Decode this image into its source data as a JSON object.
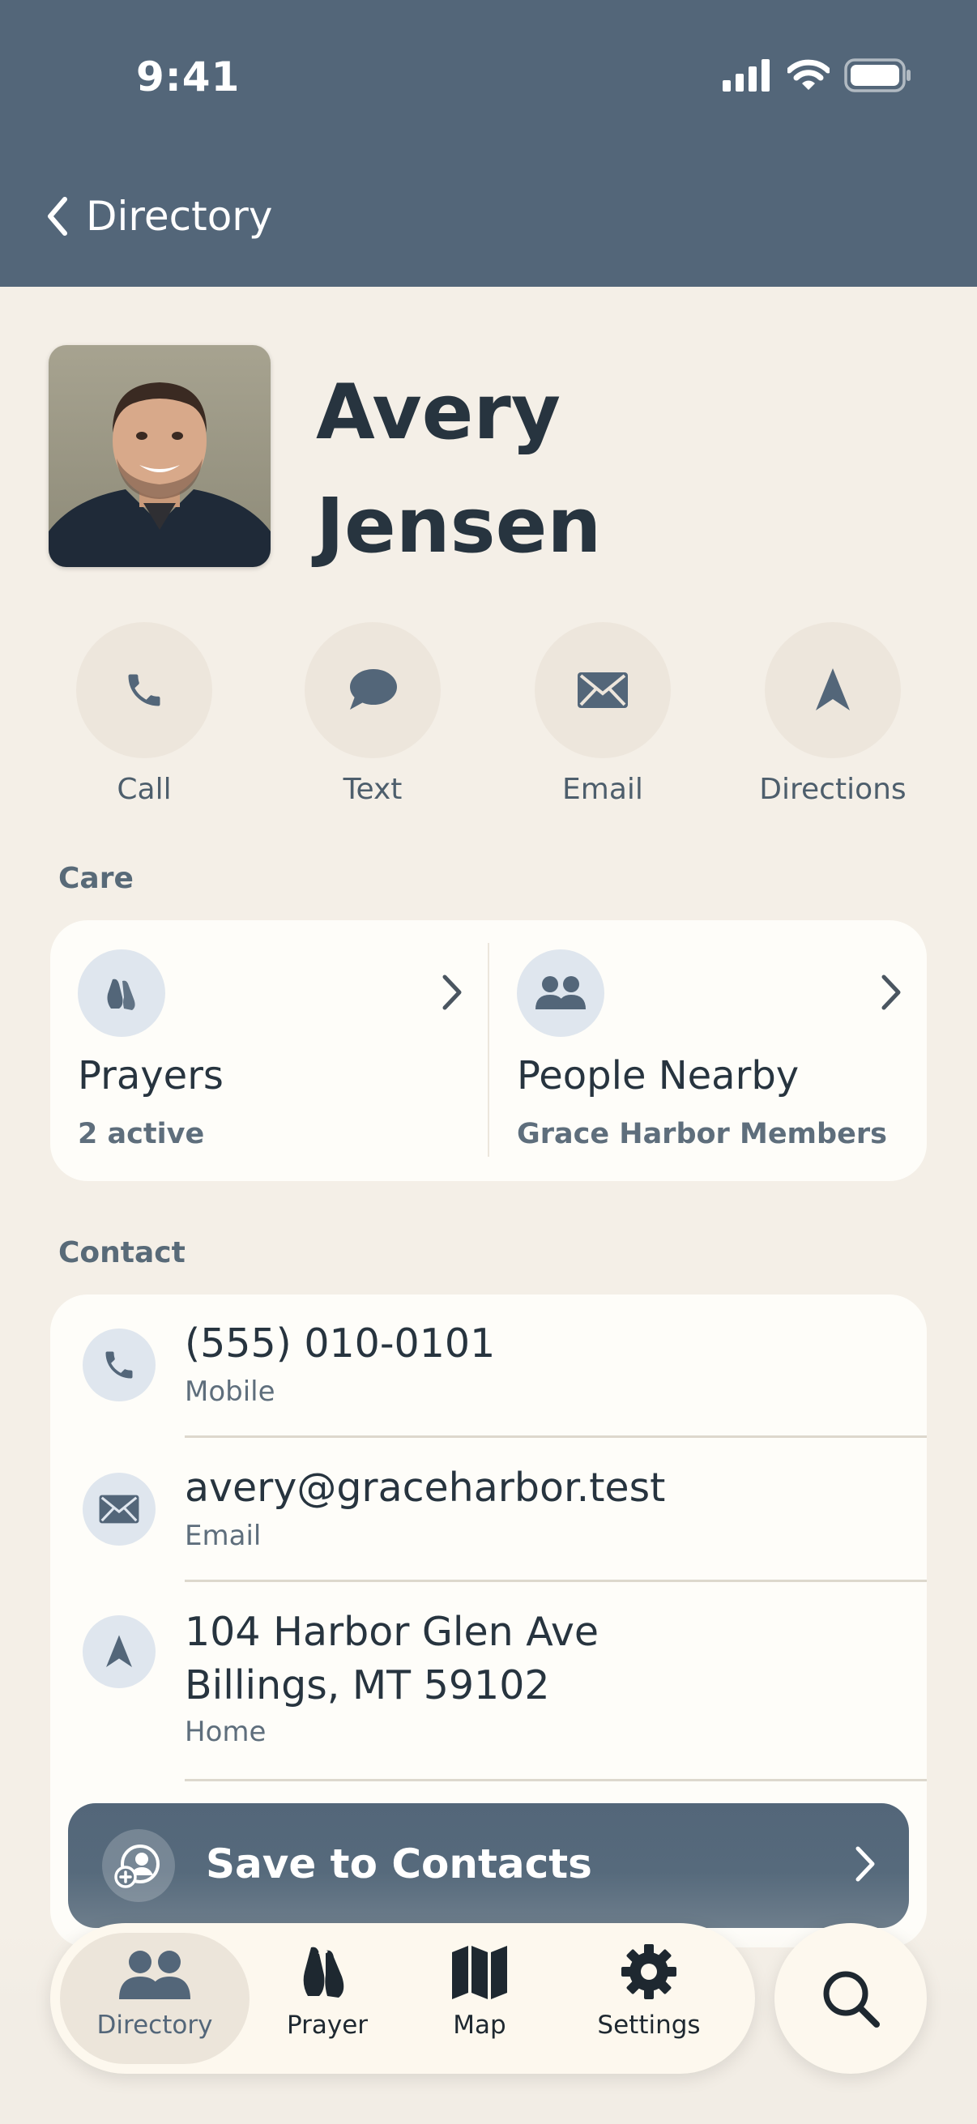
{
  "status_bar": {
    "time": "9:41"
  },
  "nav": {
    "back_label": "Directory"
  },
  "profile": {
    "first_name": "Avery",
    "last_name": "Jensen",
    "avatar_icon": "person-photo"
  },
  "actions": [
    {
      "label": "Call",
      "icon": "phone-icon"
    },
    {
      "label": "Text",
      "icon": "chat-bubble-icon"
    },
    {
      "label": "Email",
      "icon": "envelope-icon"
    },
    {
      "label": "Directions",
      "icon": "navigation-arrow-icon"
    }
  ],
  "care": {
    "section_title": "Care",
    "items": [
      {
        "title": "Prayers",
        "subtitle": "2 active",
        "icon": "praying-hands-icon"
      },
      {
        "title": "People Nearby",
        "subtitle": "Grace Harbor Members",
        "icon": "people-icon"
      }
    ]
  },
  "contact": {
    "section_title": "Contact",
    "phone": {
      "value": "(555) 010-0101",
      "label": "Mobile"
    },
    "email": {
      "value": "avery@graceharbor.test",
      "label": "Email"
    },
    "address": {
      "line1": "104 Harbor Glen Ave",
      "line2": "Billings, MT 59102",
      "label": "Home"
    }
  },
  "save_button": {
    "label": "Save to Contacts",
    "icon": "add-contact-icon"
  },
  "tabbar": {
    "tabs": [
      {
        "label": "Directory",
        "icon": "people-icon",
        "active": true
      },
      {
        "label": "Prayer",
        "icon": "praying-hands-icon",
        "active": false
      },
      {
        "label": "Map",
        "icon": "map-icon",
        "active": false
      },
      {
        "label": "Settings",
        "icon": "gear-icon",
        "active": false
      }
    ],
    "search_icon": "search-icon"
  },
  "colors": {
    "header_bg": "#536679",
    "page_bg": "#f4efe7",
    "card_bg": "#fefdf9",
    "accent": "#536679"
  }
}
